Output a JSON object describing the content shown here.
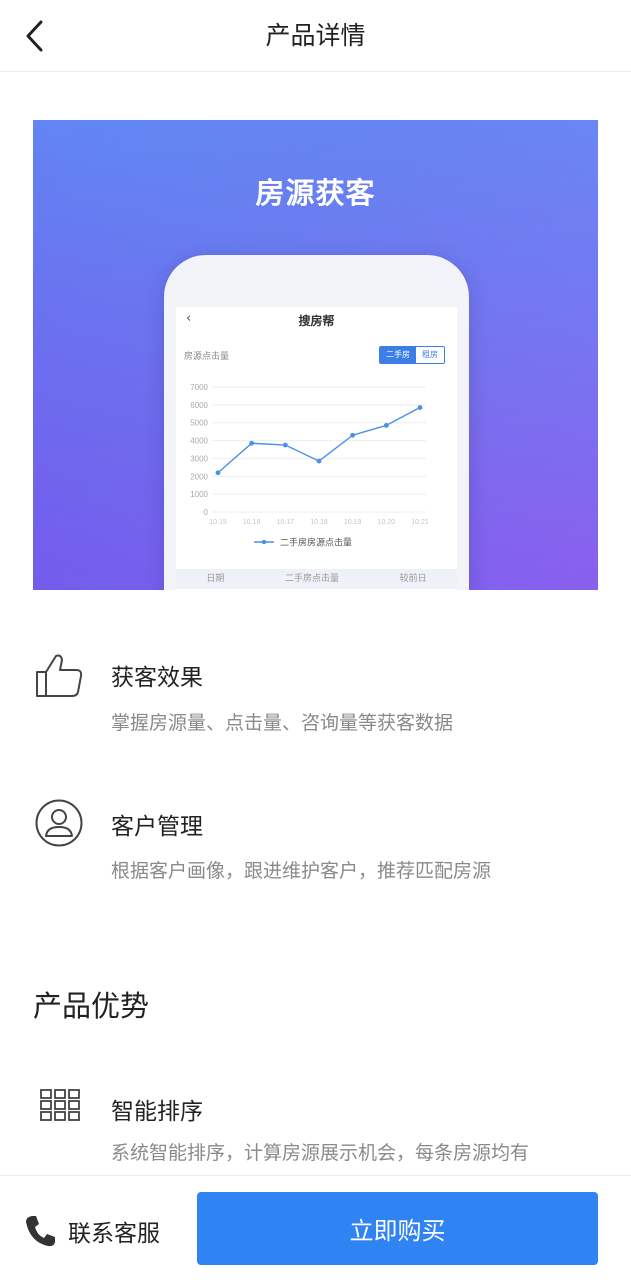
{
  "header": {
    "title": "产品详情"
  },
  "banner": {
    "title": "房源获客",
    "phone": {
      "title": "搜房帮",
      "back": "‹",
      "metric_label": "房源点击量",
      "segments": [
        "二手房",
        "租房"
      ],
      "table_headers": [
        "日期",
        "二手房点击量",
        "较前日"
      ]
    }
  },
  "chart_data": {
    "type": "line",
    "x": [
      "10.15",
      "10.16",
      "10.17",
      "10.18",
      "10.19",
      "10.20",
      "10.21"
    ],
    "series": [
      {
        "name": "二手房房源点击量",
        "values": [
          2200,
          3850,
          3750,
          2850,
          4300,
          4850,
          5850
        ]
      }
    ],
    "yticks": [
      "7000",
      "6000",
      "5000",
      "4000",
      "3000",
      "2000",
      "1000",
      "0"
    ],
    "ylim": [
      0,
      7000
    ],
    "grid": true,
    "color": "#4a90e2"
  },
  "features": [
    {
      "title": "获客效果",
      "desc": "掌握房源量、点击量、咨询量等获客数据"
    },
    {
      "title": "客户管理",
      "desc": "根据客户画像，跟进维护客户，推荐匹配房源"
    }
  ],
  "advantages": {
    "title": "产品优势",
    "items": [
      {
        "title": "智能排序",
        "desc": "系统智能排序，计算房源展示机会，每条房源均有"
      }
    ]
  },
  "bottom": {
    "contact_label": "联系客服",
    "buy_label": "立即购买"
  },
  "colors": {
    "primary": "#2f83f2",
    "banner_start": "#5f8bf5",
    "banner_end": "#8a5fee"
  }
}
